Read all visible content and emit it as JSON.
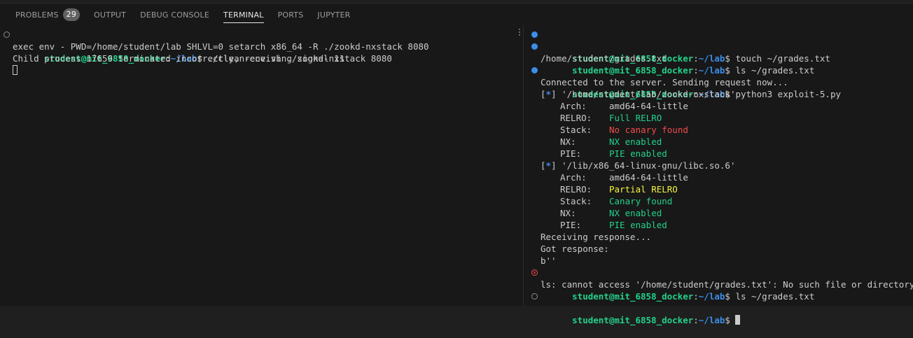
{
  "tabs": {
    "problems": "PROBLEMS",
    "problems_count": "29",
    "output": "OUTPUT",
    "debug_console": "DEBUG CONSOLE",
    "terminal": "TERMINAL",
    "ports": "PORTS",
    "jupyter": "JUPYTER"
  },
  "prompt": {
    "user_host": "student@mit_6858_docker",
    "colon": ":",
    "path": "~/lab",
    "dollar": "$"
  },
  "left": {
    "cmd1": " ./clean-env.sh ./zookd-nxstack 8080",
    "out1": "exec env - PWD=/home/student/lab SHLVL=0 setarch x86_64 -R ./zookd-nxstack 8080",
    "out2": "Child process 17659 terminated incorrectly, receiving signal 11"
  },
  "right": {
    "cmd1": " touch ~/grades.txt",
    "cmd2": " ls ~/grades.txt",
    "out_path": "/home/student/grades.txt",
    "cmd3": " python3 exploit-5.py",
    "connected": "Connected to the server. Sending request now...",
    "star": "*",
    "bin1": "'/home/student/lab/zookd-nxstack'",
    "bin2": "'/lib/x86_64-linux-gnu/libc.so.6'",
    "labels": {
      "arch": "Arch:",
      "relro": "RELRO:",
      "stack": "Stack:",
      "nx": "NX:",
      "pie": "PIE:"
    },
    "bin1_props": {
      "arch": "amd64-64-little",
      "relro": "Full RELRO",
      "stack": "No canary found",
      "nx": "NX enabled",
      "pie": "PIE enabled"
    },
    "bin2_props": {
      "arch": "amd64-64-little",
      "relro": "Partial RELRO",
      "stack": "Canary found",
      "nx": "NX enabled",
      "pie": "PIE enabled"
    },
    "receiving": "Receiving response...",
    "got": "Got response:",
    "bytes": "b''",
    "cmd4": " ls ~/grades.txt",
    "ls_error": "ls: cannot access '/home/student/grades.txt': No such file or directory"
  },
  "colors": {
    "prompt_user": "#23d18b",
    "prompt_path": "#3b8eea",
    "error": "#f14c4c",
    "warning": "#f5f543"
  }
}
